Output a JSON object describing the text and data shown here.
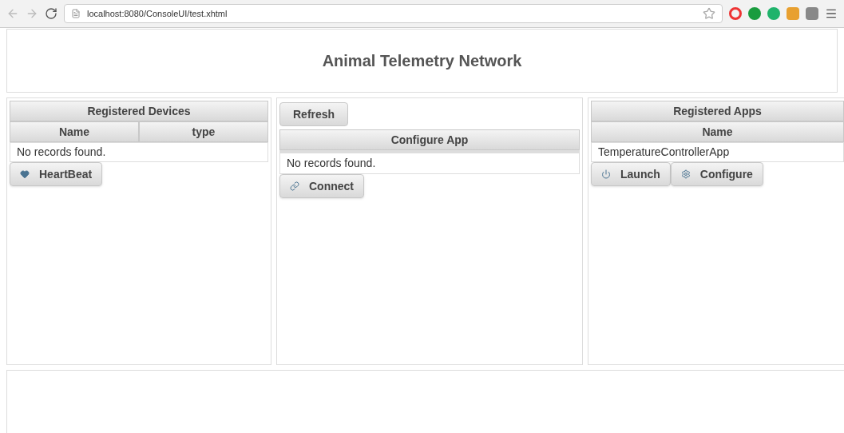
{
  "browser": {
    "url": "localhost:8080/ConsoleUI/test.xhtml"
  },
  "header": {
    "title": "Animal Telemetry Network"
  },
  "devices": {
    "title": "Registered Devices",
    "columns": [
      "Name",
      "type"
    ],
    "empty": "No records found.",
    "buttons": [
      {
        "label": "HeartBeat",
        "kind": "heartbeat"
      }
    ]
  },
  "configure": {
    "refresh": "Refresh",
    "title": "Configure App",
    "empty": "No records found.",
    "buttons": [
      {
        "label": "Connect",
        "kind": "connect"
      }
    ]
  },
  "apps": {
    "title": "Registered Apps",
    "columns": [
      "Name"
    ],
    "rows": [
      "TemperatureControllerApp"
    ],
    "buttons": [
      {
        "label": "Launch",
        "kind": "launch"
      },
      {
        "label": "Configure",
        "kind": "configure"
      }
    ]
  }
}
